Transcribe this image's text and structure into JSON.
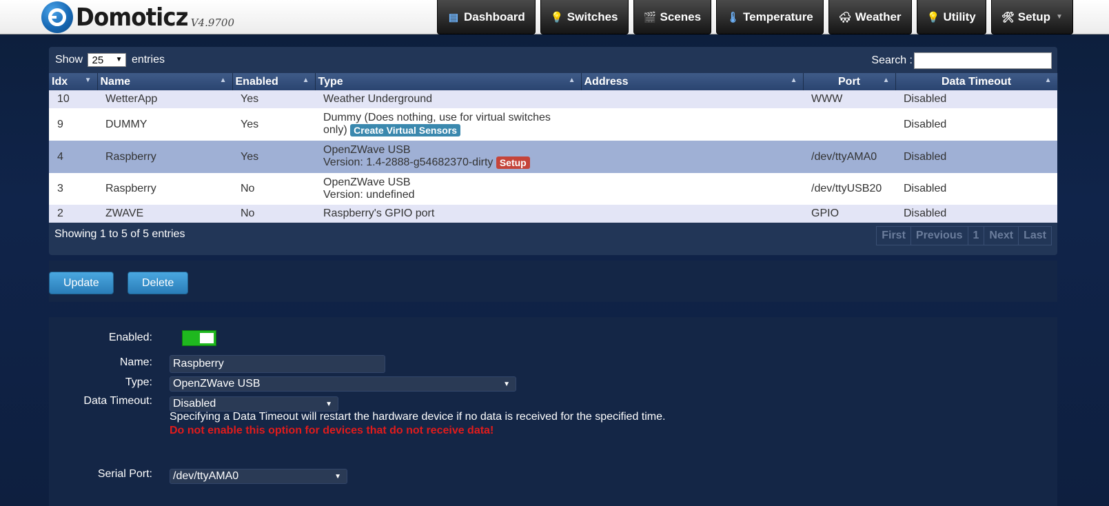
{
  "app": {
    "name": "Domoticz",
    "version": "V4.9700"
  },
  "nav": [
    {
      "label": "Dashboard",
      "icon": "dashboard-icon",
      "glyph": "▤"
    },
    {
      "label": "Switches",
      "icon": "lightbulb-icon",
      "glyph": "💡"
    },
    {
      "label": "Scenes",
      "icon": "clapperboard-icon",
      "glyph": "🎬"
    },
    {
      "label": "Temperature",
      "icon": "thermometer-icon",
      "glyph": "🌡"
    },
    {
      "label": "Weather",
      "icon": "cloud-icon",
      "glyph": "🌨"
    },
    {
      "label": "Utility",
      "icon": "utility-icon",
      "glyph": "💡"
    },
    {
      "label": "Setup",
      "icon": "tools-icon",
      "glyph": "🛠"
    }
  ],
  "table_controls": {
    "show_label": "Show",
    "page_size": "25",
    "entries_label": "entries",
    "search_label": "Search :"
  },
  "columns": [
    "Idx",
    "Name",
    "Enabled",
    "Type",
    "Address",
    "Port",
    "Data Timeout"
  ],
  "rows": [
    {
      "idx": "10",
      "name": "WetterApp",
      "enabled": "Yes",
      "type_line1": "Weather Underground",
      "type_line2": "",
      "address": "",
      "port": "WWW",
      "timeout": "Disabled"
    },
    {
      "idx": "9",
      "name": "DUMMY",
      "enabled": "Yes",
      "type_line1": "Dummy (Does nothing, use for virtual switches",
      "type_line2": "only)",
      "badge": "Create Virtual Sensors",
      "address": "",
      "port": "",
      "timeout": "Disabled"
    },
    {
      "idx": "4",
      "name": "Raspberry",
      "enabled": "Yes",
      "type_line1": "OpenZWave USB",
      "type_line2": "Version: 1.4-2888-g54682370-dirty",
      "badge": "Setup",
      "address": "",
      "port": "/dev/ttyAMA0",
      "timeout": "Disabled"
    },
    {
      "idx": "3",
      "name": "Raspberry",
      "enabled": "No",
      "type_line1": "OpenZWave USB",
      "type_line2": "Version: undefined",
      "address": "",
      "port": "/dev/ttyUSB20",
      "timeout": "Disabled"
    },
    {
      "idx": "2",
      "name": "ZWAVE",
      "enabled": "No",
      "type_line1": "Raspberry's GPIO port",
      "type_line2": "",
      "address": "",
      "port": "GPIO",
      "timeout": "Disabled"
    }
  ],
  "table_info": "Showing 1 to 5 of 5 entries",
  "pager": [
    "First",
    "Previous",
    "1",
    "Next",
    "Last"
  ],
  "buttons": {
    "update": "Update",
    "delete": "Delete"
  },
  "form": {
    "enabled_label": "Enabled:",
    "enabled_value": true,
    "name_label": "Name:",
    "name_value": "Raspberry",
    "type_label": "Type:",
    "type_value": "OpenZWave USB",
    "timeout_label": "Data Timeout:",
    "timeout_value": "Disabled",
    "help_text": "Specifying a Data Timeout will restart the hardware device if no data is received for the specified time.",
    "warning_text": "Do not enable this option for devices that do not receive data!",
    "serial_label": "Serial Port:",
    "serial_value": "/dev/ttyAMA0"
  },
  "colors": {
    "toggle_on": "#1fb81f",
    "warning": "#e21b1b",
    "badge_blue": "#3a88ae",
    "badge_red": "#c54439",
    "selected_row": "#9fb0d5"
  }
}
